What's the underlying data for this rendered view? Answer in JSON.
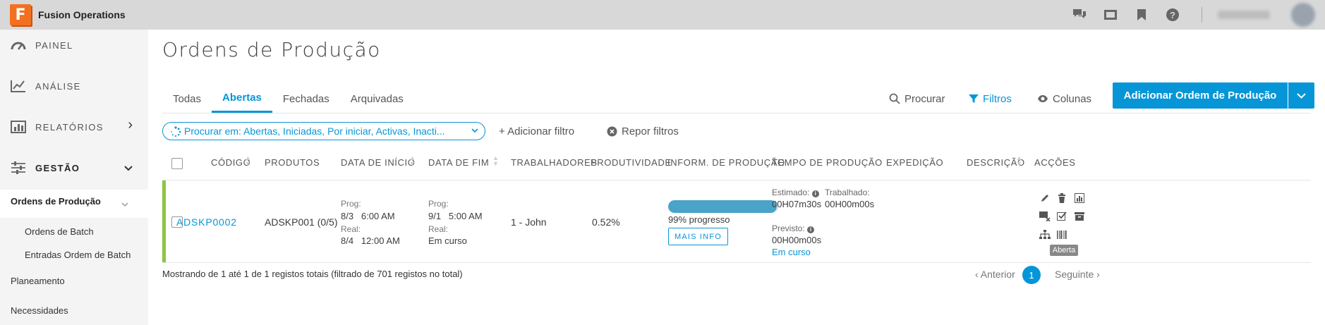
{
  "app": {
    "title": "Fusion Operations",
    "logo_letter": "F"
  },
  "topbar": {
    "icons": [
      "chat-icon",
      "screen-icon",
      "bookmark-icon",
      "help-icon"
    ]
  },
  "sidebar": {
    "items": [
      {
        "label": "PAINEL",
        "icon": "dashboard-icon"
      },
      {
        "label": "ANÁLISE",
        "icon": "analysis-icon"
      },
      {
        "label": "RELATÓRIOS",
        "icon": "reports-icon",
        "chevron": "›"
      },
      {
        "label": "GESTÃO",
        "icon": "sliders-icon",
        "chevron": "⌄"
      }
    ],
    "sub": {
      "active": "Ordens de Produção",
      "items": [
        "Ordens de Batch",
        "Entradas Ordem de Batch"
      ]
    },
    "sections": [
      "Planeamento",
      "Necessidades"
    ]
  },
  "page": {
    "title": "Ordens de Produção"
  },
  "tabs": [
    "Todas",
    "Abertas",
    "Fechadas",
    "Arquivadas"
  ],
  "toolbar": {
    "search": "Procurar",
    "filters": "Filtros",
    "columns": "Colunas",
    "add": "Adicionar Ordem de Produção"
  },
  "filter": {
    "pill": "Procurar em: Abertas, Iniciadas, Por iniciar, Activas, Inacti...",
    "add": "+ Adicionar filtro",
    "reset": "Repor filtros"
  },
  "table": {
    "headers": [
      "CÓDIGO",
      "PRODUTOS",
      "DATA DE INÍCIO",
      "DATA DE FIM",
      "TRABALHADORES",
      "PRODUTIVIDADE",
      "INFORM. DE PRODUÇÃO",
      "TEMPO DE PRODUÇÃO",
      "EXPEDIÇÃO",
      "DESCRIÇÃO",
      "ACÇÕES"
    ],
    "row": {
      "code": "ADSKP0002",
      "product": "ADSKP001 (0/5)",
      "start": {
        "prog_label": "Prog:",
        "prog": "8/3   6:00 AM",
        "real_label": "Real:",
        "real": "8/4   12:00 AM"
      },
      "end": {
        "prog_label": "Prog:",
        "prog": "9/1   5:00 AM",
        "real_label": "Real:",
        "real": "Em curso"
      },
      "workers": "1 - John",
      "productivity": "0.52%",
      "progress": {
        "percent": 99,
        "text": "99% progresso",
        "button": "MAIS INFO"
      },
      "time": {
        "estimated_label": "Estimado:",
        "estimated": "00H07m30s",
        "worked_label": "Trabalhado:",
        "worked": "00H00m00s",
        "forecast_label": "Previsto:",
        "forecast": "00H00m00s",
        "status": "Em curso"
      },
      "tooltip": "Aberta"
    }
  },
  "footer": {
    "summary": "Mostrando de 1 até 1 de 1 registos totais (filtrado de 701 registos no total)",
    "prev": "‹ Anterior",
    "page": "1",
    "next": "Seguinte ›"
  }
}
